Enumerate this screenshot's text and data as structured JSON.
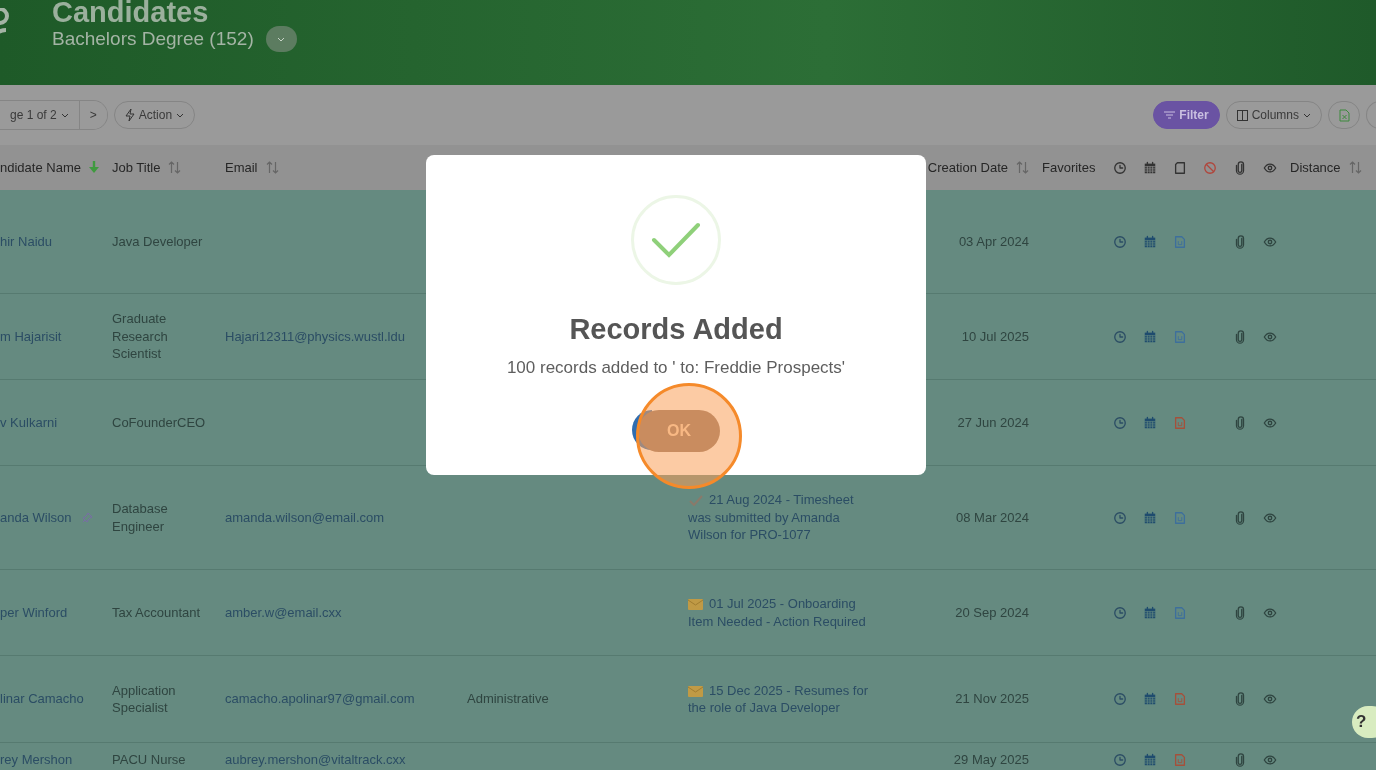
{
  "header": {
    "title": "Candidates",
    "subtitle": "Bachelors Degree (152)"
  },
  "toolbar": {
    "pager": "ge 1 of 2",
    "next": ">",
    "action": "Action",
    "filter": "Filter",
    "columns": "Columns"
  },
  "table": {
    "columns": [
      {
        "label": "ndidate Name",
        "kind": "sorted"
      },
      {
        "label": "Job Title",
        "kind": "sortable"
      },
      {
        "label": "Email",
        "kind": "sortable"
      },
      {
        "label": "Creation Date",
        "kind": "sortable"
      },
      {
        "label": "Favorites",
        "kind": "plain"
      },
      {
        "label": "Distance",
        "kind": "sortable"
      }
    ],
    "rows": [
      {
        "name": "hir Naidu",
        "pinned": false,
        "job_title": "Java Developer",
        "creation_date": "03 Apr 2024",
        "resume_icon": {
          "color": "#3d6f9c"
        }
      },
      {
        "name": "m Hajarisit",
        "pinned": false,
        "job_title": "Graduate Research Scientist",
        "email": "Hajari12311@physics.wustl.ldu",
        "creation_date": "10 Jul 2025",
        "resume_icon": {
          "color": "#3d6f9c"
        }
      },
      {
        "name": "v Kulkarni",
        "pinned": false,
        "job_title": "CoFounderCEO",
        "creation_date": "27 Jun 2024",
        "resume_icon": {
          "color": "#a5503a"
        }
      },
      {
        "name": "anda Wilson",
        "pinned": true,
        "job_title": "Database Engineer",
        "email": "amanda.wilson@email.com",
        "activity": {
          "kind": "check",
          "text": "21 Aug 2024 - Timesheet was submitted by Amanda Wilson for PRO-1077"
        },
        "creation_date": "08 Mar 2024",
        "resume_icon": {
          "color": "#3d6f9c"
        }
      },
      {
        "name": "per Winford",
        "pinned": false,
        "job_title": "Tax Accountant",
        "email": "amber.w@email.cxx",
        "activity": {
          "kind": "mail",
          "text": "01 Jul 2025 - Onboarding Item Needed - Action Required"
        },
        "creation_date": "20 Sep 2024",
        "resume_icon": {
          "color": "#3d6f9c"
        }
      },
      {
        "name": "linar Camacho",
        "pinned": false,
        "job_title": "Application Specialist",
        "email": "camacho.apolinar97@gmail.com",
        "column_4": "Administrative",
        "activity": {
          "kind": "mail",
          "text": "15 Dec 2025 - Resumes for the role of Java Developer"
        },
        "creation_date": "21 Nov 2025",
        "resume_icon": {
          "color": "#a5503a"
        }
      },
      {
        "name": "rey Mershon",
        "pinned": false,
        "job_title": "PACU Nurse",
        "email": "aubrey.mershon@vitaltrack.cxx",
        "creation_date": "29 May 2025",
        "resume_icon": {
          "color": "#a5503a"
        }
      }
    ]
  },
  "dialog": {
    "title": "Records Added",
    "message": "100 records added to ' to: Freddie Prospects'",
    "ok": "OK"
  },
  "help_button": "?"
}
